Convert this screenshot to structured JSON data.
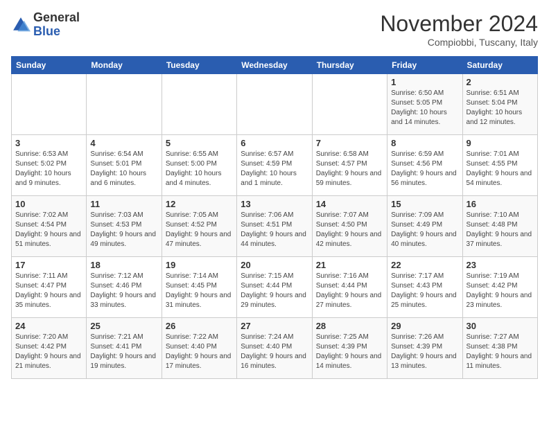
{
  "header": {
    "logo_general": "General",
    "logo_blue": "Blue",
    "month": "November 2024",
    "location": "Compiobbi, Tuscany, Italy"
  },
  "weekdays": [
    "Sunday",
    "Monday",
    "Tuesday",
    "Wednesday",
    "Thursday",
    "Friday",
    "Saturday"
  ],
  "weeks": [
    [
      {
        "day": "",
        "info": ""
      },
      {
        "day": "",
        "info": ""
      },
      {
        "day": "",
        "info": ""
      },
      {
        "day": "",
        "info": ""
      },
      {
        "day": "",
        "info": ""
      },
      {
        "day": "1",
        "info": "Sunrise: 6:50 AM\nSunset: 5:05 PM\nDaylight: 10 hours and 14 minutes."
      },
      {
        "day": "2",
        "info": "Sunrise: 6:51 AM\nSunset: 5:04 PM\nDaylight: 10 hours and 12 minutes."
      }
    ],
    [
      {
        "day": "3",
        "info": "Sunrise: 6:53 AM\nSunset: 5:02 PM\nDaylight: 10 hours and 9 minutes."
      },
      {
        "day": "4",
        "info": "Sunrise: 6:54 AM\nSunset: 5:01 PM\nDaylight: 10 hours and 6 minutes."
      },
      {
        "day": "5",
        "info": "Sunrise: 6:55 AM\nSunset: 5:00 PM\nDaylight: 10 hours and 4 minutes."
      },
      {
        "day": "6",
        "info": "Sunrise: 6:57 AM\nSunset: 4:59 PM\nDaylight: 10 hours and 1 minute."
      },
      {
        "day": "7",
        "info": "Sunrise: 6:58 AM\nSunset: 4:57 PM\nDaylight: 9 hours and 59 minutes."
      },
      {
        "day": "8",
        "info": "Sunrise: 6:59 AM\nSunset: 4:56 PM\nDaylight: 9 hours and 56 minutes."
      },
      {
        "day": "9",
        "info": "Sunrise: 7:01 AM\nSunset: 4:55 PM\nDaylight: 9 hours and 54 minutes."
      }
    ],
    [
      {
        "day": "10",
        "info": "Sunrise: 7:02 AM\nSunset: 4:54 PM\nDaylight: 9 hours and 51 minutes."
      },
      {
        "day": "11",
        "info": "Sunrise: 7:03 AM\nSunset: 4:53 PM\nDaylight: 9 hours and 49 minutes."
      },
      {
        "day": "12",
        "info": "Sunrise: 7:05 AM\nSunset: 4:52 PM\nDaylight: 9 hours and 47 minutes."
      },
      {
        "day": "13",
        "info": "Sunrise: 7:06 AM\nSunset: 4:51 PM\nDaylight: 9 hours and 44 minutes."
      },
      {
        "day": "14",
        "info": "Sunrise: 7:07 AM\nSunset: 4:50 PM\nDaylight: 9 hours and 42 minutes."
      },
      {
        "day": "15",
        "info": "Sunrise: 7:09 AM\nSunset: 4:49 PM\nDaylight: 9 hours and 40 minutes."
      },
      {
        "day": "16",
        "info": "Sunrise: 7:10 AM\nSunset: 4:48 PM\nDaylight: 9 hours and 37 minutes."
      }
    ],
    [
      {
        "day": "17",
        "info": "Sunrise: 7:11 AM\nSunset: 4:47 PM\nDaylight: 9 hours and 35 minutes."
      },
      {
        "day": "18",
        "info": "Sunrise: 7:12 AM\nSunset: 4:46 PM\nDaylight: 9 hours and 33 minutes."
      },
      {
        "day": "19",
        "info": "Sunrise: 7:14 AM\nSunset: 4:45 PM\nDaylight: 9 hours and 31 minutes."
      },
      {
        "day": "20",
        "info": "Sunrise: 7:15 AM\nSunset: 4:44 PM\nDaylight: 9 hours and 29 minutes."
      },
      {
        "day": "21",
        "info": "Sunrise: 7:16 AM\nSunset: 4:44 PM\nDaylight: 9 hours and 27 minutes."
      },
      {
        "day": "22",
        "info": "Sunrise: 7:17 AM\nSunset: 4:43 PM\nDaylight: 9 hours and 25 minutes."
      },
      {
        "day": "23",
        "info": "Sunrise: 7:19 AM\nSunset: 4:42 PM\nDaylight: 9 hours and 23 minutes."
      }
    ],
    [
      {
        "day": "24",
        "info": "Sunrise: 7:20 AM\nSunset: 4:42 PM\nDaylight: 9 hours and 21 minutes."
      },
      {
        "day": "25",
        "info": "Sunrise: 7:21 AM\nSunset: 4:41 PM\nDaylight: 9 hours and 19 minutes."
      },
      {
        "day": "26",
        "info": "Sunrise: 7:22 AM\nSunset: 4:40 PM\nDaylight: 9 hours and 17 minutes."
      },
      {
        "day": "27",
        "info": "Sunrise: 7:24 AM\nSunset: 4:40 PM\nDaylight: 9 hours and 16 minutes."
      },
      {
        "day": "28",
        "info": "Sunrise: 7:25 AM\nSunset: 4:39 PM\nDaylight: 9 hours and 14 minutes."
      },
      {
        "day": "29",
        "info": "Sunrise: 7:26 AM\nSunset: 4:39 PM\nDaylight: 9 hours and 13 minutes."
      },
      {
        "day": "30",
        "info": "Sunrise: 7:27 AM\nSunset: 4:38 PM\nDaylight: 9 hours and 11 minutes."
      }
    ]
  ]
}
